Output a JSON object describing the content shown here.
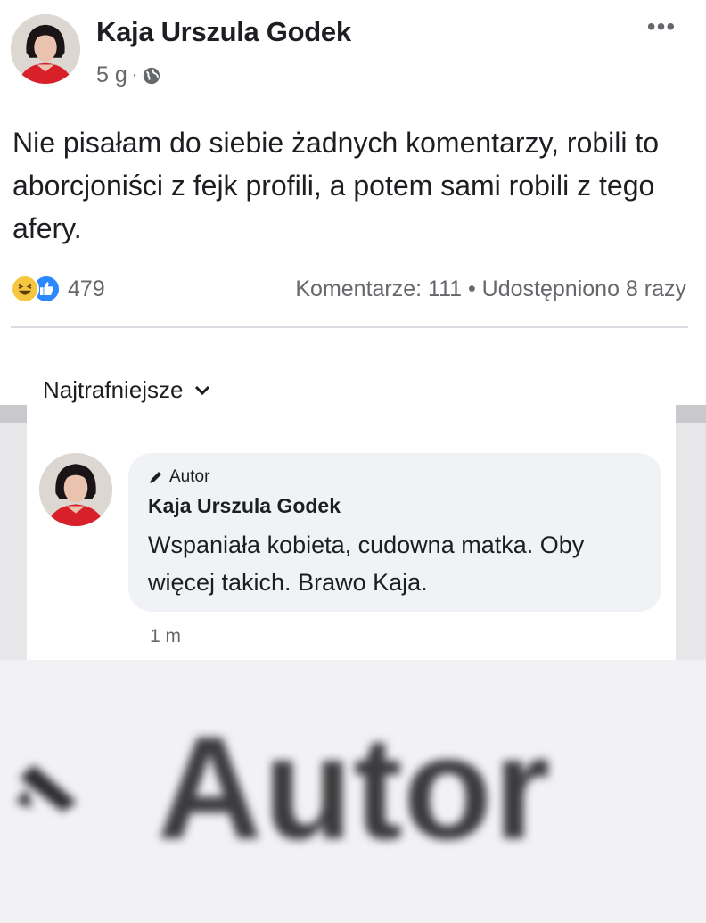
{
  "post": {
    "author": "Kaja Urszula Godek",
    "time": "5 g",
    "separator": "·",
    "privacy_icon": "globe-icon",
    "more_label": "•••",
    "text": "Nie pisałam do siebie żadnych komentarzy, robili to aborcjoniści z fejk profili, a potem sami robili z tego afery.",
    "reactions": {
      "icons": [
        "haha-icon",
        "like-icon"
      ],
      "count": "479"
    },
    "stats": "Komentarze: 111 • Udostępniono 8 razy"
  },
  "sort": {
    "label": "Najtrafniejsze",
    "icon": "chevron-down-icon"
  },
  "comment": {
    "badge": "Autor",
    "badge_icon": "pencil-icon",
    "author": "Kaja Urszula Godek",
    "text": "Wspaniała kobieta, cudowna matka. Oby więcej takich. Brawo Kaja.",
    "time": "1 m"
  },
  "zoom": {
    "label": "Autor",
    "icon": "pencil-icon"
  },
  "colors": {
    "text": "#1c1e21",
    "secondary_text": "#65676b",
    "like_blue": "#2d88ff",
    "haha_yellow": "#f7c640",
    "bubble_bg": "#f0f2f5",
    "avatar_red": "#d8202a"
  }
}
